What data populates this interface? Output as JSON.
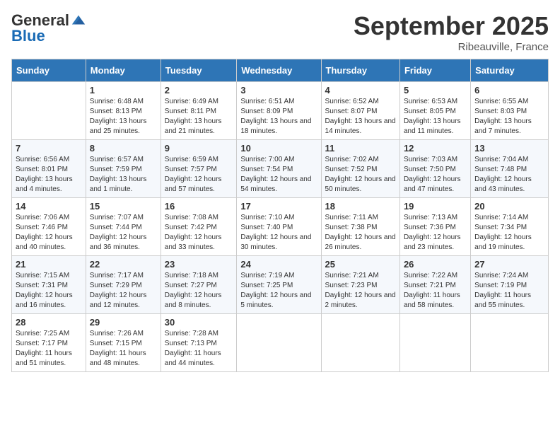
{
  "logo": {
    "general": "General",
    "blue": "Blue"
  },
  "header": {
    "title": "September 2025",
    "subtitle": "Ribeauville, France"
  },
  "days_of_week": [
    "Sunday",
    "Monday",
    "Tuesday",
    "Wednesday",
    "Thursday",
    "Friday",
    "Saturday"
  ],
  "weeks": [
    [
      {
        "num": "",
        "info": ""
      },
      {
        "num": "1",
        "info": "Sunrise: 6:48 AM\nSunset: 8:13 PM\nDaylight: 13 hours and 25 minutes."
      },
      {
        "num": "2",
        "info": "Sunrise: 6:49 AM\nSunset: 8:11 PM\nDaylight: 13 hours and 21 minutes."
      },
      {
        "num": "3",
        "info": "Sunrise: 6:51 AM\nSunset: 8:09 PM\nDaylight: 13 hours and 18 minutes."
      },
      {
        "num": "4",
        "info": "Sunrise: 6:52 AM\nSunset: 8:07 PM\nDaylight: 13 hours and 14 minutes."
      },
      {
        "num": "5",
        "info": "Sunrise: 6:53 AM\nSunset: 8:05 PM\nDaylight: 13 hours and 11 minutes."
      },
      {
        "num": "6",
        "info": "Sunrise: 6:55 AM\nSunset: 8:03 PM\nDaylight: 13 hours and 7 minutes."
      }
    ],
    [
      {
        "num": "7",
        "info": "Sunrise: 6:56 AM\nSunset: 8:01 PM\nDaylight: 13 hours and 4 minutes."
      },
      {
        "num": "8",
        "info": "Sunrise: 6:57 AM\nSunset: 7:59 PM\nDaylight: 13 hours and 1 minute."
      },
      {
        "num": "9",
        "info": "Sunrise: 6:59 AM\nSunset: 7:57 PM\nDaylight: 12 hours and 57 minutes."
      },
      {
        "num": "10",
        "info": "Sunrise: 7:00 AM\nSunset: 7:54 PM\nDaylight: 12 hours and 54 minutes."
      },
      {
        "num": "11",
        "info": "Sunrise: 7:02 AM\nSunset: 7:52 PM\nDaylight: 12 hours and 50 minutes."
      },
      {
        "num": "12",
        "info": "Sunrise: 7:03 AM\nSunset: 7:50 PM\nDaylight: 12 hours and 47 minutes."
      },
      {
        "num": "13",
        "info": "Sunrise: 7:04 AM\nSunset: 7:48 PM\nDaylight: 12 hours and 43 minutes."
      }
    ],
    [
      {
        "num": "14",
        "info": "Sunrise: 7:06 AM\nSunset: 7:46 PM\nDaylight: 12 hours and 40 minutes."
      },
      {
        "num": "15",
        "info": "Sunrise: 7:07 AM\nSunset: 7:44 PM\nDaylight: 12 hours and 36 minutes."
      },
      {
        "num": "16",
        "info": "Sunrise: 7:08 AM\nSunset: 7:42 PM\nDaylight: 12 hours and 33 minutes."
      },
      {
        "num": "17",
        "info": "Sunrise: 7:10 AM\nSunset: 7:40 PM\nDaylight: 12 hours and 30 minutes."
      },
      {
        "num": "18",
        "info": "Sunrise: 7:11 AM\nSunset: 7:38 PM\nDaylight: 12 hours and 26 minutes."
      },
      {
        "num": "19",
        "info": "Sunrise: 7:13 AM\nSunset: 7:36 PM\nDaylight: 12 hours and 23 minutes."
      },
      {
        "num": "20",
        "info": "Sunrise: 7:14 AM\nSunset: 7:34 PM\nDaylight: 12 hours and 19 minutes."
      }
    ],
    [
      {
        "num": "21",
        "info": "Sunrise: 7:15 AM\nSunset: 7:31 PM\nDaylight: 12 hours and 16 minutes."
      },
      {
        "num": "22",
        "info": "Sunrise: 7:17 AM\nSunset: 7:29 PM\nDaylight: 12 hours and 12 minutes."
      },
      {
        "num": "23",
        "info": "Sunrise: 7:18 AM\nSunset: 7:27 PM\nDaylight: 12 hours and 8 minutes."
      },
      {
        "num": "24",
        "info": "Sunrise: 7:19 AM\nSunset: 7:25 PM\nDaylight: 12 hours and 5 minutes."
      },
      {
        "num": "25",
        "info": "Sunrise: 7:21 AM\nSunset: 7:23 PM\nDaylight: 12 hours and 2 minutes."
      },
      {
        "num": "26",
        "info": "Sunrise: 7:22 AM\nSunset: 7:21 PM\nDaylight: 11 hours and 58 minutes."
      },
      {
        "num": "27",
        "info": "Sunrise: 7:24 AM\nSunset: 7:19 PM\nDaylight: 11 hours and 55 minutes."
      }
    ],
    [
      {
        "num": "28",
        "info": "Sunrise: 7:25 AM\nSunset: 7:17 PM\nDaylight: 11 hours and 51 minutes."
      },
      {
        "num": "29",
        "info": "Sunrise: 7:26 AM\nSunset: 7:15 PM\nDaylight: 11 hours and 48 minutes."
      },
      {
        "num": "30",
        "info": "Sunrise: 7:28 AM\nSunset: 7:13 PM\nDaylight: 11 hours and 44 minutes."
      },
      {
        "num": "",
        "info": ""
      },
      {
        "num": "",
        "info": ""
      },
      {
        "num": "",
        "info": ""
      },
      {
        "num": "",
        "info": ""
      }
    ]
  ]
}
